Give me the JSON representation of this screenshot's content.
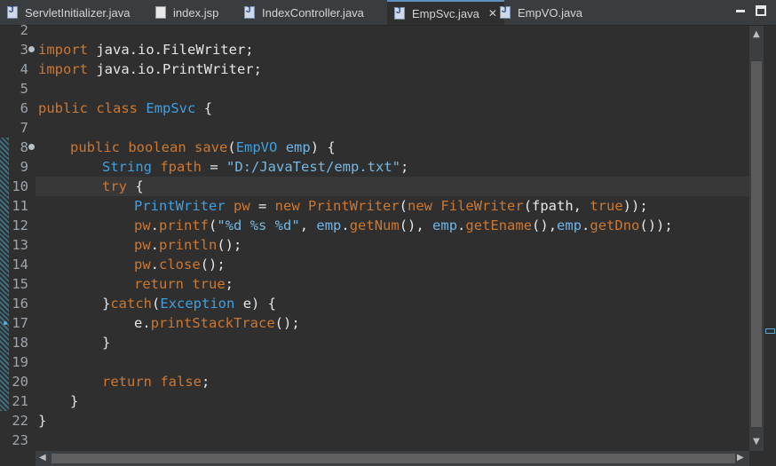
{
  "tabs": [
    {
      "label": "ServletInitializer.java",
      "icon": "java-file-icon"
    },
    {
      "label": "index.jsp",
      "icon": "jsp-file-icon"
    },
    {
      "label": "IndexController.java",
      "icon": "java-file-icon"
    },
    {
      "label": "EmpSvc.java",
      "icon": "java-file-icon",
      "active": true,
      "close": "✕"
    },
    {
      "label": "EmpVO.java",
      "icon": "java-file-icon"
    }
  ],
  "line_numbers": [
    "2",
    "3",
    "4",
    "5",
    "6",
    "7",
    "8",
    "9",
    "10",
    "11",
    "12",
    "13",
    "14",
    "15",
    "16",
    "17",
    "18",
    "19",
    "20",
    "21",
    "22",
    "23"
  ],
  "code": {
    "l3_a": "import",
    "l3_b": " java.io.FileWriter;",
    "l4_a": "import",
    "l4_b": " java.io.PrintWriter;",
    "l6_a": "public",
    "l6_b": " ",
    "l6_c": "class",
    "l6_d": " ",
    "l6_e": "EmpSvc",
    "l6_f": " {",
    "l8_a": "public",
    "l8_b": " ",
    "l8_c": "boolean",
    "l8_d": " ",
    "l8_e": "save",
    "l8_f": "(",
    "l8_g": "EmpVO",
    "l8_h": " ",
    "l8_i": "emp",
    "l8_j": ") {",
    "l9_a": "String",
    "l9_b": " ",
    "l9_c": "fpath",
    "l9_d": " = ",
    "l9_e": "\"D:/JavaTest/emp.txt\"",
    "l9_f": ";",
    "l10_a": "try",
    "l10_b": " {",
    "l11_a": "PrintWriter",
    "l11_b": " ",
    "l11_c": "pw",
    "l11_d": " = ",
    "l11_e": "new",
    "l11_f": " ",
    "l11_g": "PrintWriter",
    "l11_h": "(",
    "l11_i": "new",
    "l11_j": " ",
    "l11_k": "FileWriter",
    "l11_l": "(fpath, ",
    "l11_m": "true",
    "l11_n": "));",
    "l12_a": "pw",
    "l12_b": ".",
    "l12_c": "printf",
    "l12_d": "(",
    "l12_e": "\"%d %s %d\"",
    "l12_f": ", ",
    "l12_g": "emp",
    "l12_h": ".",
    "l12_i": "getNum",
    "l12_j": "(), ",
    "l12_k": "emp",
    "l12_l": ".",
    "l12_m": "getEname",
    "l12_n": "(),",
    "l12_o": "emp",
    "l12_p": ".",
    "l12_q": "getDno",
    "l12_r": "());",
    "l13_a": "pw",
    "l13_b": ".",
    "l13_c": "println",
    "l13_d": "();",
    "l14_a": "pw",
    "l14_b": ".",
    "l14_c": "close",
    "l14_d": "();",
    "l15_a": "return",
    "l15_b": " ",
    "l15_c": "true",
    "l15_d": ";",
    "l16_a": "}",
    "l16_b": "catch",
    "l16_c": "(",
    "l16_d": "Exception",
    "l16_e": " e) {",
    "l17_a": "e",
    "l17_b": ".",
    "l17_c": "printStackTrace",
    "l17_d": "();",
    "l18_a": "}",
    "l20_a": "return",
    "l20_b": " ",
    "l20_c": "false",
    "l20_d": ";",
    "l21_a": "}",
    "l22_a": "}"
  },
  "scrollbar": {
    "up": "▲",
    "down": "▼",
    "left": "◀",
    "right": "▶"
  },
  "colors": {
    "keyword": "#cc7832",
    "type": "#3fa0e0",
    "string": "#77b7e0",
    "background": "#2f2f2f"
  }
}
